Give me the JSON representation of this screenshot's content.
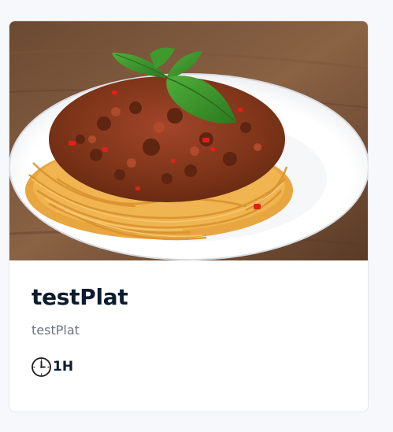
{
  "recipe_card": {
    "title": "testPlat",
    "description": "testPlat",
    "duration": "1H",
    "image_alt": "spaghetti-bolognese-photo",
    "duration_icon": "clock-icon"
  },
  "colors": {
    "page_background": "#f7f8fb",
    "card_background": "#ffffff",
    "title": "#0d1b2e",
    "description": "#6b7280"
  }
}
